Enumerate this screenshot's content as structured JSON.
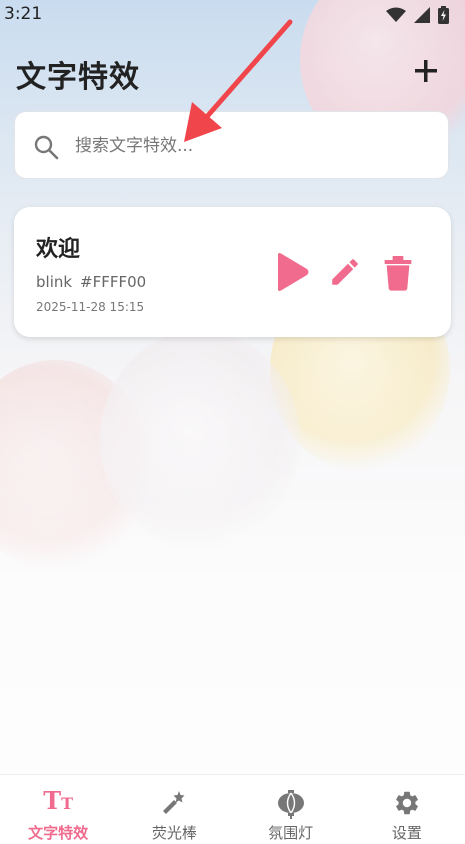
{
  "status_bar": {
    "time": "3:21"
  },
  "header": {
    "title": "文字特效"
  },
  "search": {
    "placeholder": "搜索文字特效..."
  },
  "items": [
    {
      "title": "欢迎",
      "effect": "blink",
      "color": "#FFFF00",
      "created": "2025-11-28 15:15"
    }
  ],
  "nav": [
    {
      "label": "文字特效",
      "icon": "text-effect-icon",
      "active": true
    },
    {
      "label": "荧光棒",
      "icon": "glow-stick-icon",
      "active": false
    },
    {
      "label": "氛围灯",
      "icon": "lantern-icon",
      "active": false
    },
    {
      "label": "设置",
      "icon": "gear-icon",
      "active": false
    }
  ],
  "colors": {
    "accent": "#F06B8E",
    "annotation_arrow": "#F0454B"
  }
}
